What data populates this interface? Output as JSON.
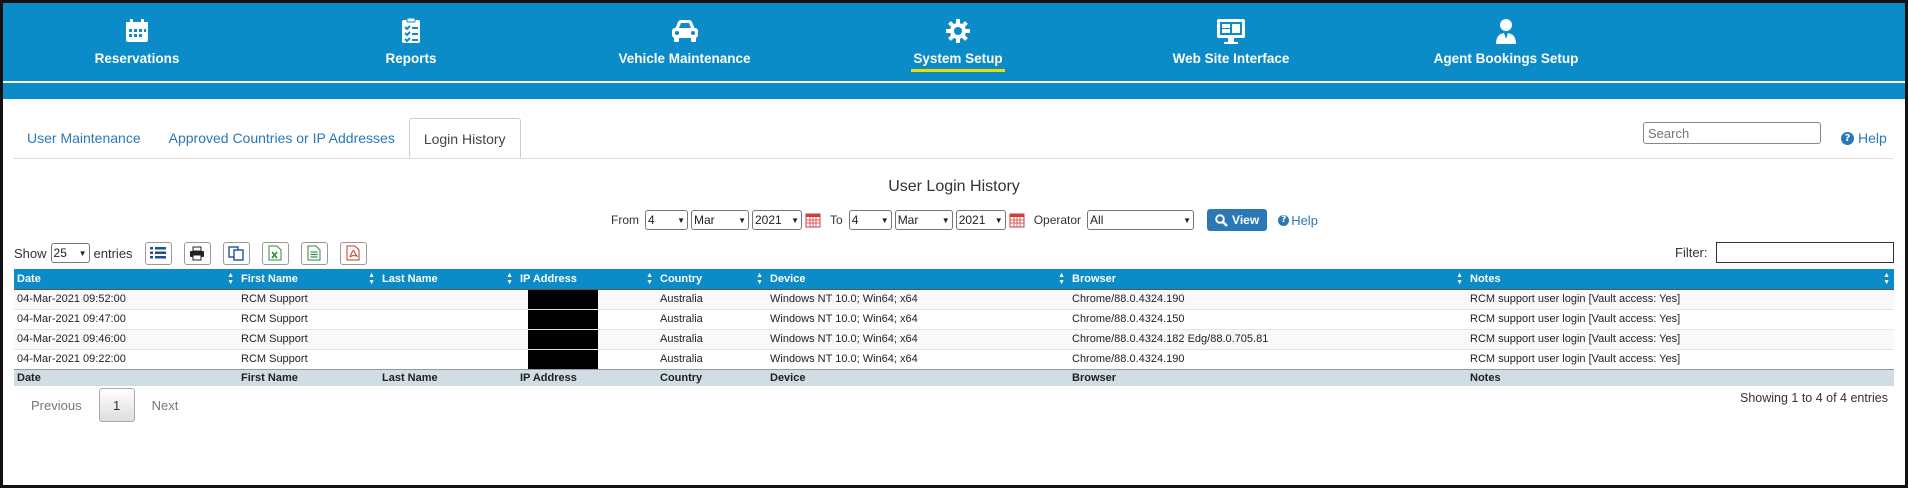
{
  "nav": {
    "items": [
      {
        "label": "Reservations",
        "icon": "calendar-icon"
      },
      {
        "label": "Reports",
        "icon": "checklist-icon"
      },
      {
        "label": "Vehicle Maintenance",
        "icon": "car-icon"
      },
      {
        "label": "System Setup",
        "icon": "gear-icon",
        "active": true
      },
      {
        "label": "Web Site Interface",
        "icon": "monitor-icon"
      },
      {
        "label": "Agent Bookings Setup",
        "icon": "agent-icon"
      }
    ]
  },
  "tabs": [
    {
      "label": "User Maintenance"
    },
    {
      "label": "Approved Countries or IP Addresses"
    },
    {
      "label": "Login History",
      "active": true
    }
  ],
  "search": {
    "placeholder": "Search"
  },
  "help_label": "Help",
  "page_title": "User Login History",
  "filters": {
    "from_label": "From",
    "from_day": "4",
    "from_month": "Mar",
    "from_year": "2021",
    "to_label": "To",
    "to_day": "4",
    "to_month": "Mar",
    "to_year": "2021",
    "operator_label": "Operator",
    "operator_value": "All",
    "view_label": "View",
    "help_label": "Help"
  },
  "entries": {
    "show_label": "Show",
    "count": "25",
    "entries_label": "entries",
    "filter_label": "Filter:"
  },
  "table": {
    "columns": [
      "Date",
      "First Name",
      "Last Name",
      "IP Address",
      "Country",
      "Device",
      "Browser",
      "Notes"
    ],
    "rows": [
      [
        "04-Mar-2021 09:52:00",
        "RCM Support",
        "",
        "",
        "Australia",
        "Windows NT 10.0; Win64; x64",
        "Chrome/88.0.4324.190",
        "RCM support user login [Vault access: Yes]"
      ],
      [
        "04-Mar-2021 09:47:00",
        "RCM Support",
        "",
        "",
        "Australia",
        "Windows NT 10.0; Win64; x64",
        "Chrome/88.0.4324.150",
        "RCM support user login [Vault access: Yes]"
      ],
      [
        "04-Mar-2021 09:46:00",
        "RCM Support",
        "",
        "",
        "Australia",
        "Windows NT 10.0; Win64; x64",
        "Chrome/88.0.4324.182 Edg/88.0.705.81",
        "RCM support user login [Vault access: Yes]"
      ],
      [
        "04-Mar-2021 09:22:00",
        "RCM Support",
        "",
        "",
        "Australia",
        "Windows NT 10.0; Win64; x64",
        "Chrome/88.0.4324.190",
        "RCM support user login [Vault access: Yes]"
      ]
    ]
  },
  "pager": {
    "previous": "Previous",
    "current": "1",
    "next": "Next",
    "summary": "Showing 1 to 4 of 4 entries"
  },
  "colors": {
    "accent": "#0b8bc7",
    "link": "#2a79b6",
    "underline": "#e6e000"
  }
}
